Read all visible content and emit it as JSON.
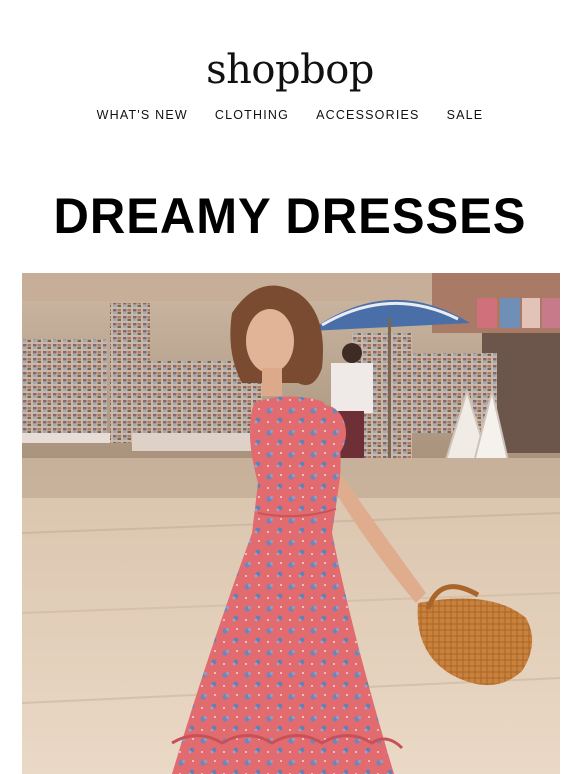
{
  "brand": {
    "logo_text": "shopbop"
  },
  "nav": {
    "items": [
      {
        "label": "WHAT'S NEW"
      },
      {
        "label": "CLOTHING"
      },
      {
        "label": "ACCESSORIES"
      },
      {
        "label": "SALE"
      }
    ]
  },
  "hero": {
    "headline": "DREAMY DRESSES",
    "image_subject": "model-in-pink-floral-dress-with-wicker-bag"
  },
  "colors": {
    "text": "#111111",
    "headline": "#000000",
    "background": "#ffffff",
    "dress": "#e06a6d",
    "pavement": "#e8d6c2",
    "umbrella": "#4a6fa8",
    "bag": "#c9823c"
  }
}
